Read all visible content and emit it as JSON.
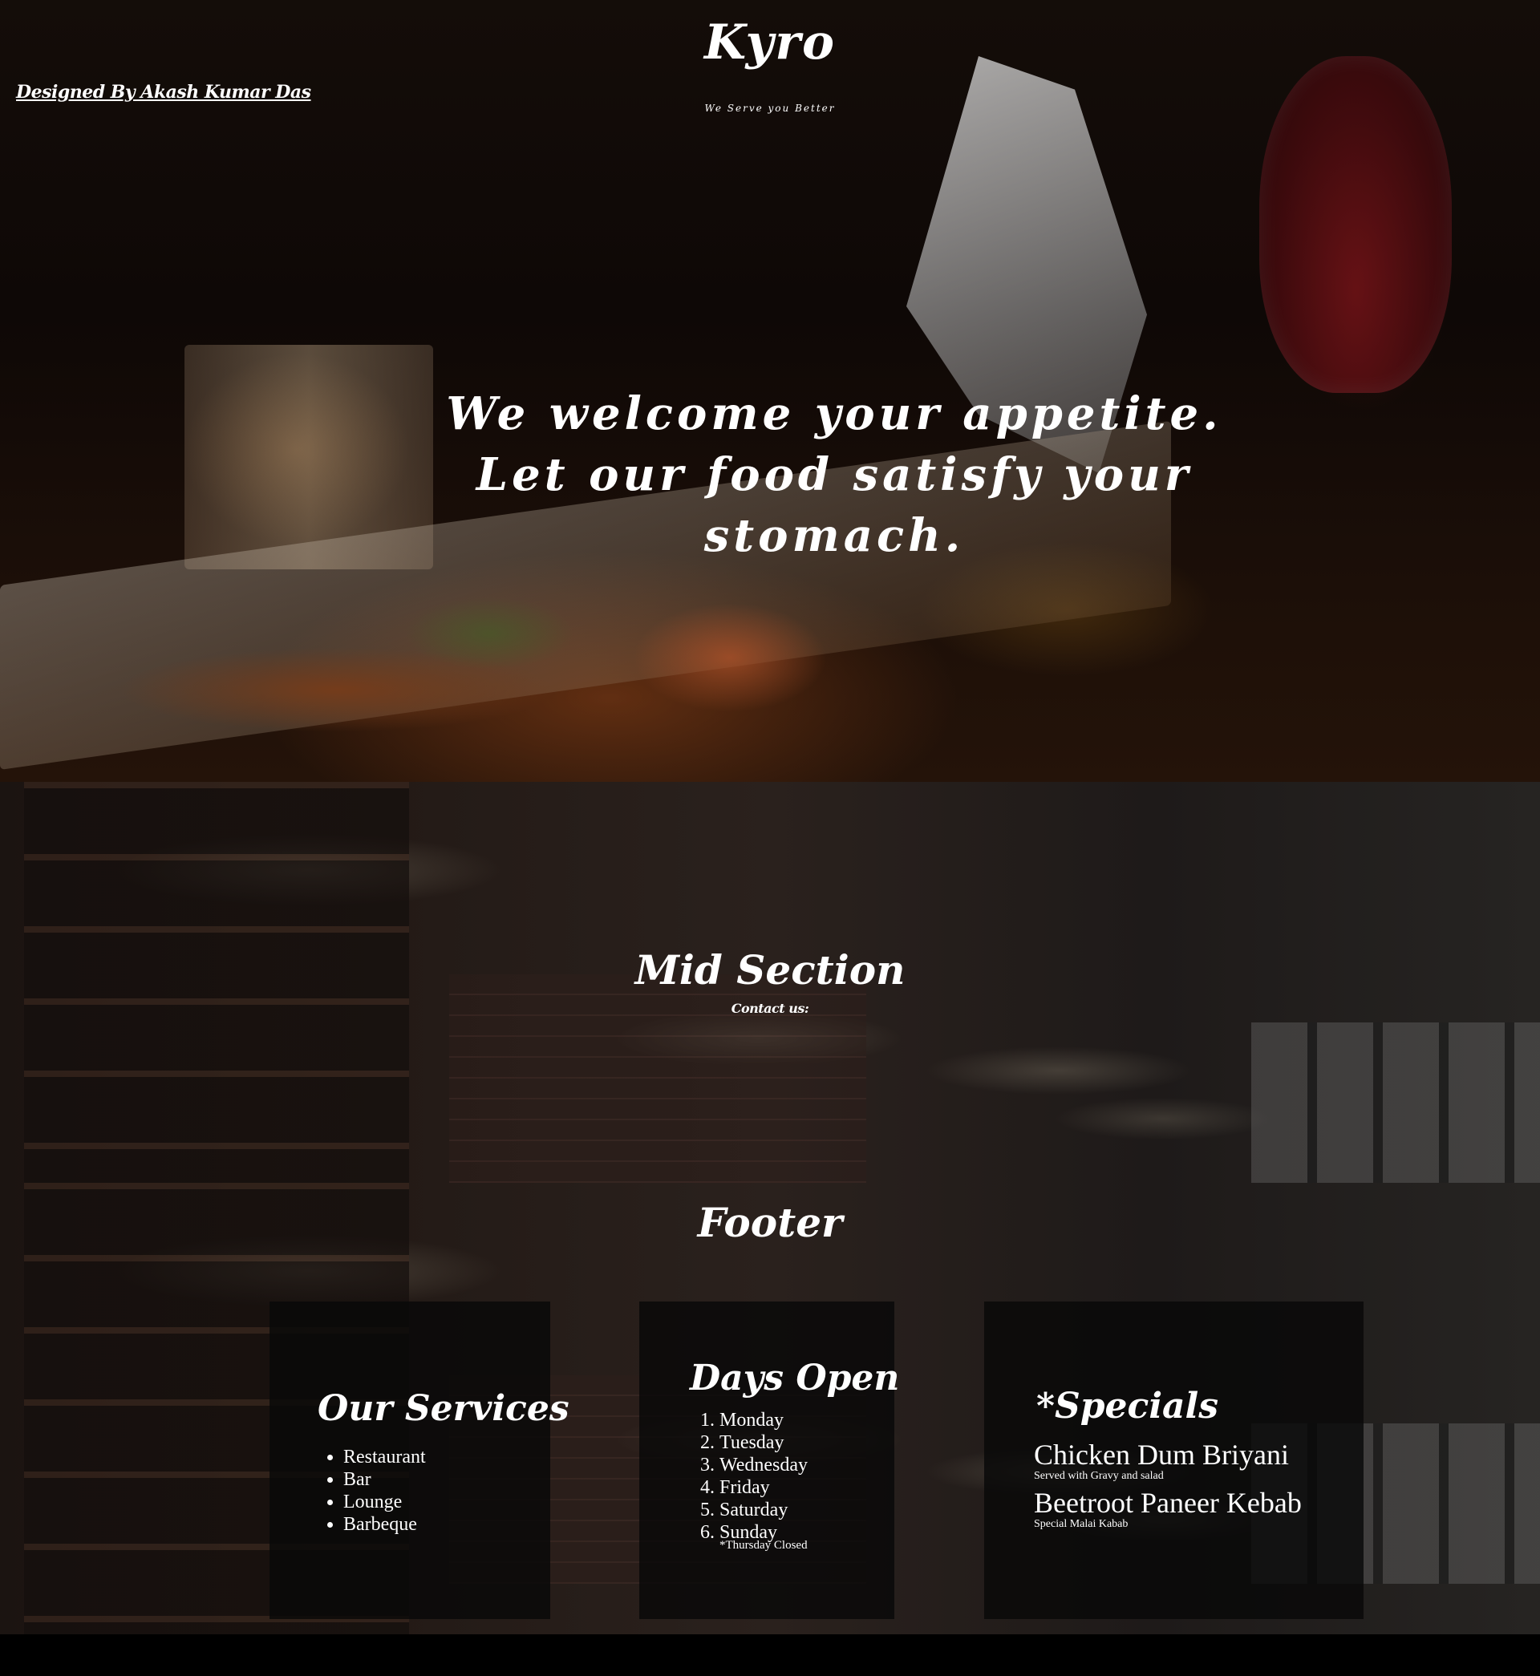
{
  "header": {
    "credit": "Designed By Akash Kumar Das",
    "logo": "Kyro",
    "tagline": "We Serve you Better"
  },
  "hero": {
    "headline": "We welcome your appetite. Let our food satisfy your stomach."
  },
  "mid": {
    "title": "Mid Section",
    "subtitle": "Contact us:"
  },
  "footer": {
    "title": "Footer",
    "services": {
      "title": "Our Services",
      "items": [
        "Restaurant",
        "Bar",
        "Lounge",
        "Barbeque"
      ]
    },
    "days": {
      "title": "Days Open",
      "items": [
        "Monday",
        "Tuesday",
        "Wednesday",
        "Friday",
        "Saturday",
        "Sunday"
      ],
      "note": "*Thursday Closed"
    },
    "specials": {
      "title": "*Specials",
      "items": [
        {
          "name": "Chicken Dum Briyani",
          "desc": "Served with Gravy and salad"
        },
        {
          "name": "Beetroot Paneer Kebab",
          "desc": "Special Malai Kabab"
        }
      ]
    }
  }
}
